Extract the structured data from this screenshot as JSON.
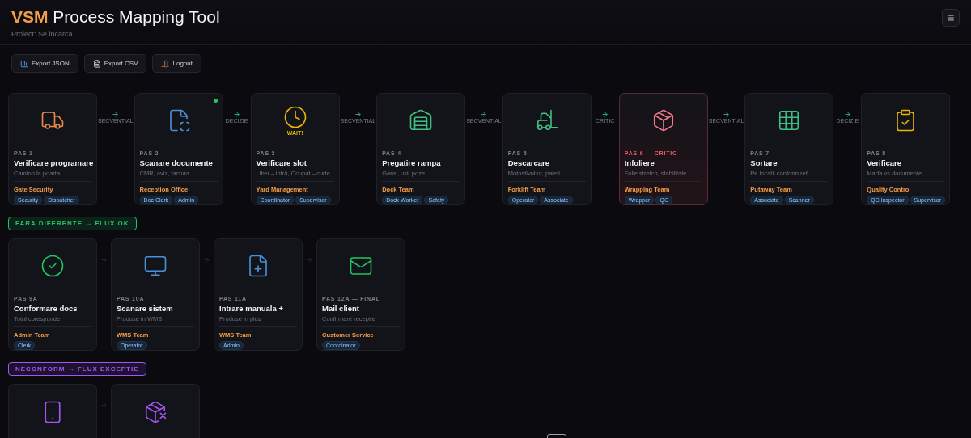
{
  "header": {
    "brand": "VSM",
    "title": "Process Mapping Tool",
    "subtitle": "Proiect: Se incarca..."
  },
  "toolbar": [
    {
      "label": "Export JSON"
    },
    {
      "label": "Export CSV"
    },
    {
      "label": "Logout"
    }
  ],
  "sections": [
    {
      "steps": [
        {
          "pas": "PAS 1",
          "title": "Verificare programare",
          "subtitle": "Camion la poarta",
          "team": "Gate Security",
          "roles": [
            "Security",
            "Dispatcher"
          ],
          "active": false,
          "critical": false,
          "link": "SECVENTIAL"
        },
        {
          "pas": "PAS 2",
          "title": "Scanare documente",
          "subtitle": "CMR, aviz, factura",
          "team": "Reception Office",
          "roles": [
            "Doc Clerk",
            "Admin"
          ],
          "active": true,
          "critical": false,
          "link": "DECIZIE"
        },
        {
          "pas": "PAS 3",
          "title": "Verificare slot",
          "subtitle": "Liber→intră, Ocupat→curte",
          "team": "Yard Management",
          "roles": [
            "Coordinator",
            "Supervisor"
          ],
          "active": false,
          "critical": false,
          "link": "SECVENTIAL",
          "icon_label": "WAIT!"
        },
        {
          "pas": "PAS 4",
          "title": "Pregatire rampa",
          "subtitle": "Garat, usi, poze",
          "team": "Dock Team",
          "roles": [
            "Dock Worker",
            "Safety"
          ],
          "active": false,
          "critical": false,
          "link": "SECVENTIAL"
        },
        {
          "pas": "PAS 5",
          "title": "Descarcare",
          "subtitle": "Motostivuitor, paleti",
          "team": "Forklift Team",
          "roles": [
            "Operator",
            "Associate"
          ],
          "active": false,
          "critical": false,
          "link": "CRITIC"
        },
        {
          "pas": "PAS 6 — CRITIC",
          "title": "Infoliere",
          "subtitle": "Folie stretch, stabilitate",
          "team": "Wrapping Team",
          "roles": [
            "Wrapper",
            "QC"
          ],
          "active": false,
          "critical": true,
          "link": "SECVENTIAL"
        },
        {
          "pas": "PAS 7",
          "title": "Sortare",
          "subtitle": "Pe locatii conform ref",
          "team": "Putaway Team",
          "roles": [
            "Associate",
            "Scanner"
          ],
          "active": false,
          "critical": false,
          "link": "DECIZIE"
        },
        {
          "pas": "PAS 8",
          "title": "Verificare",
          "subtitle": "Marfa vs documente",
          "team": "Quality Control",
          "roles": [
            "QC Inspector",
            "Supervisor"
          ],
          "active": false,
          "critical": false
        }
      ]
    },
    {
      "label": "FARA DIFERENTE → FLUX OK",
      "color": "#22c55e",
      "steps": [
        {
          "pas": "PAS 9A",
          "title": "Conformare docs",
          "subtitle": "Totul corespunde",
          "team": "Admin Team",
          "roles": [
            "Clerk"
          ],
          "active": false,
          "critical": false
        },
        {
          "pas": "PAS 10A",
          "title": "Scanare sistem",
          "subtitle": "Produse in WMS",
          "team": "WMS Team",
          "roles": [
            "Operator"
          ],
          "active": false,
          "critical": false
        },
        {
          "pas": "PAS 11A",
          "title": "Intrare manuala +",
          "subtitle": "Produse in plus",
          "team": "WMS Team",
          "roles": [
            "Admin"
          ],
          "active": false,
          "critical": false
        },
        {
          "pas": "PAS 12A — FINAL",
          "title": "Mail client",
          "subtitle": "Confirmare receptie",
          "team": "Customer Service",
          "roles": [
            "Coordinator"
          ],
          "active": false,
          "critical": false
        }
      ]
    },
    {
      "label": "NECONFORM → FLUX EXCEPTIE",
      "color": "#a855f7",
      "steps": [
        {
          "active": false,
          "critical": false
        },
        {
          "active": false,
          "critical": false
        }
      ]
    }
  ]
}
